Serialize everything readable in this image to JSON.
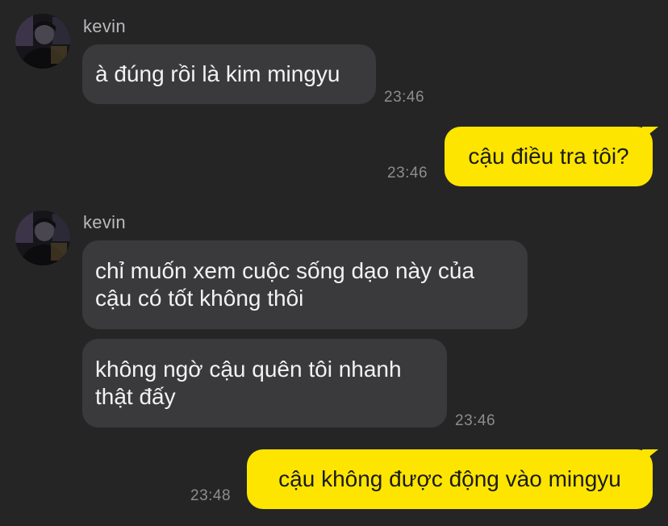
{
  "colors": {
    "background": "#252526",
    "incoming_bubble": "#3a3a3c",
    "outgoing_bubble": "#fee500",
    "timestamp": "#8d8d90",
    "sender_name": "#b9b9bd"
  },
  "messages": [
    {
      "direction": "incoming",
      "sender": "kevin",
      "avatar_icon": "profile-photo-icon",
      "bubbles": [
        {
          "text": "à đúng rồi là kim mingyu"
        }
      ],
      "time": "23:46"
    },
    {
      "direction": "outgoing",
      "bubbles": [
        {
          "text": "cậu điều tra tôi?"
        }
      ],
      "time": "23:46"
    },
    {
      "direction": "incoming",
      "sender": "kevin",
      "avatar_icon": "profile-photo-icon",
      "bubbles": [
        {
          "text": "chỉ muốn xem cuộc sống dạo này của\ncậu có tốt không thôi"
        },
        {
          "text": "không ngờ cậu quên tôi nhanh\nthật đấy"
        }
      ],
      "time": "23:46"
    },
    {
      "direction": "outgoing",
      "bubbles": [
        {
          "text": "cậu không được động vào mingyu"
        }
      ],
      "time": "23:48"
    }
  ]
}
